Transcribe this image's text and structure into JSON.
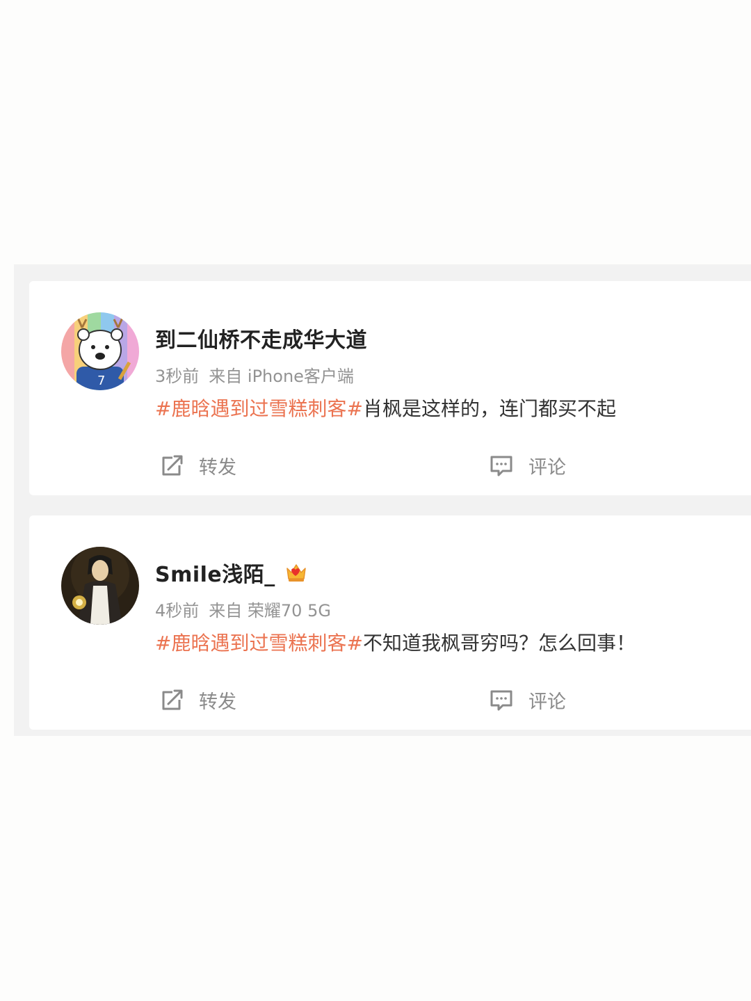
{
  "posts": [
    {
      "user_name": "到二仙桥不走成华大道",
      "time": "3秒前",
      "source": "来自 iPhone客户端",
      "topic": "#鹿晗遇到过雪糕刺客#",
      "text": "肖枫是这样的，连门都买不起",
      "repost_label": "转发",
      "comment_label": "评论",
      "avatar": "cartoon-bear-avatar",
      "vip_badge": false
    },
    {
      "user_name": "Smile浅陌_",
      "time": "4秒前",
      "source": "来自 荣耀70 5G",
      "topic": "#鹿晗遇到过雪糕刺客#",
      "text": "不知道我枫哥穷吗？怎么回事！",
      "repost_label": "转发",
      "comment_label": "评论",
      "avatar": "painting-portrait-avatar",
      "vip_badge": true
    }
  ],
  "colors": {
    "topic": "#eb7350",
    "text": "#333333",
    "meta": "#939393",
    "feed_background": "#f2f2f2"
  },
  "icons": {
    "repost": "repost-icon",
    "comment": "comment-icon",
    "vip": "vip-crown-icon"
  }
}
